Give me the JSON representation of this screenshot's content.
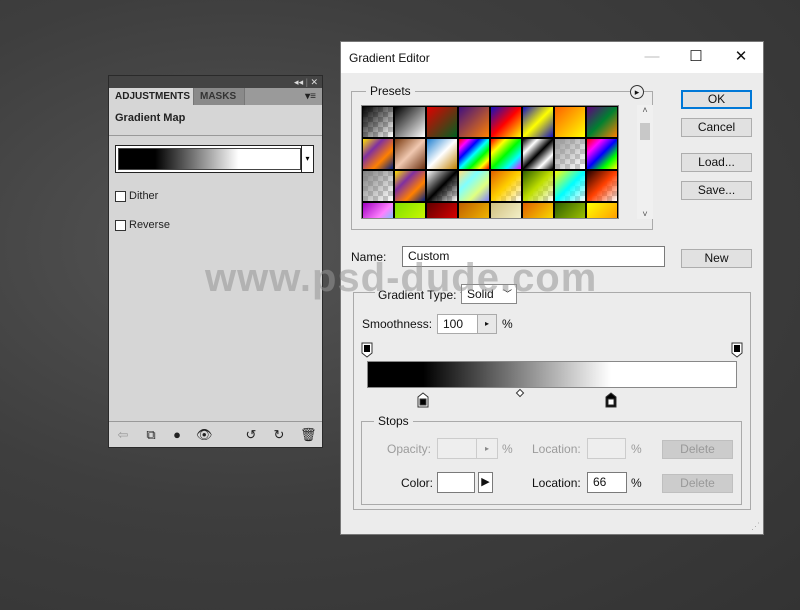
{
  "watermark": "www.psd-dude.com",
  "adjustments_panel": {
    "collapse_glyph": "◂◂",
    "close_glyph": "✕",
    "tabs": [
      {
        "label": "ADJUSTMENTS",
        "active": true
      },
      {
        "label": "MASKS",
        "active": false
      }
    ],
    "menu_glyph": "▾≡",
    "title": "Gradient Map",
    "gradient_stops": [
      "#000000",
      "#ffffff"
    ],
    "dropdown_glyph": "▾",
    "dither_label": "Dither",
    "dither_checked": false,
    "reverse_label": "Reverse",
    "reverse_checked": false,
    "footer_icons": [
      "back-arrow-icon",
      "expand-view-icon",
      "clip-layer-icon",
      "visibility-eye-icon",
      "previous-state-icon",
      "reset-icon",
      "trash-icon"
    ]
  },
  "gradient_editor": {
    "title": "Gradient Editor",
    "window_buttons": {
      "minimize": "—",
      "maximize": "☐",
      "close": "✕"
    },
    "presets_label": "Presets",
    "presets_menu_glyph": "▸",
    "presets": [
      [
        "#000000,transparent",
        "#000000,#ffffff",
        "#e00000,#006020",
        "#401080,#ff8000",
        "#1010c0,#ff0000,#ffff00",
        "#1010c0,#ffff00,#1010c0",
        "#ff6000,#ffff00",
        "#600080,#008030,#ff8000"
      ],
      [
        "#ffe000,#8030a0,#ff8000,#002080",
        "#7a3a10,#f0c8b0,#6a3010",
        "#2080d0,#ffffff,#c08000",
        "#ff0000,#ff00ff,#0000ff,#00ffff,#00ff00,#ffff00,#ff0000",
        "#ff0000,#ffff00,#00ff00,#00ffff,#ff00ff",
        "#000000,#ffffff,#000000,#ffffff,#000000",
        "#999999,transparent",
        "#ff0000,#ff00ff,#0000ff,#00ff00,#ffff00"
      ],
      [
        "#808080,transparent",
        "#ffe000,#8030a0,#ff8000,#002080",
        "#ffffff,#000000,transparent",
        "#ffe080,#80ffff,#e0ff80,#8080ff",
        "#e06000,#ffd000,transparent",
        "#306000,#c0e000,transparent",
        "#ffff00,#00ffff,transparent",
        "#200000,#ff4000,transparent"
      ],
      [
        "#a000c0,#ff80ff,#00ffff",
        "#80e000,#e0ff00",
        "#600000,#ff0000",
        "#c06000,#ffd000",
        "#d0c080,#ffffe0",
        "#e06000,#ffff00",
        "#306000,#c0e000",
        "#ffff00,#ff8000"
      ]
    ],
    "scroll_up": "˄",
    "scroll_down": "˅",
    "buttons": {
      "ok": "OK",
      "cancel": "Cancel",
      "load": "Load...",
      "save": "Save...",
      "new": "New"
    },
    "name_label": "Name:",
    "name_value": "Custom",
    "gradient_type_label": "Gradient Type:",
    "gradient_type_value": "Solid",
    "smoothness_label": "Smoothness:",
    "smoothness_value": "100",
    "percent": "%",
    "gradient": {
      "opacity_stops": [
        {
          "location": 0,
          "opacity": 100
        },
        {
          "location": 100,
          "opacity": 100
        }
      ],
      "color_stops": [
        {
          "location": 15,
          "color": "#000000"
        },
        {
          "location": 66,
          "color": "#ffffff",
          "selected": true
        }
      ],
      "midpoint": 41
    },
    "stops": {
      "label": "Stops",
      "opacity_label": "Opacity:",
      "opacity_value": "",
      "opacity_location_label": "Location:",
      "opacity_location_value": "",
      "color_label": "Color:",
      "color_value": "#ffffff",
      "color_location_label": "Location:",
      "color_location_value": "66",
      "delete_label": "Delete"
    }
  }
}
